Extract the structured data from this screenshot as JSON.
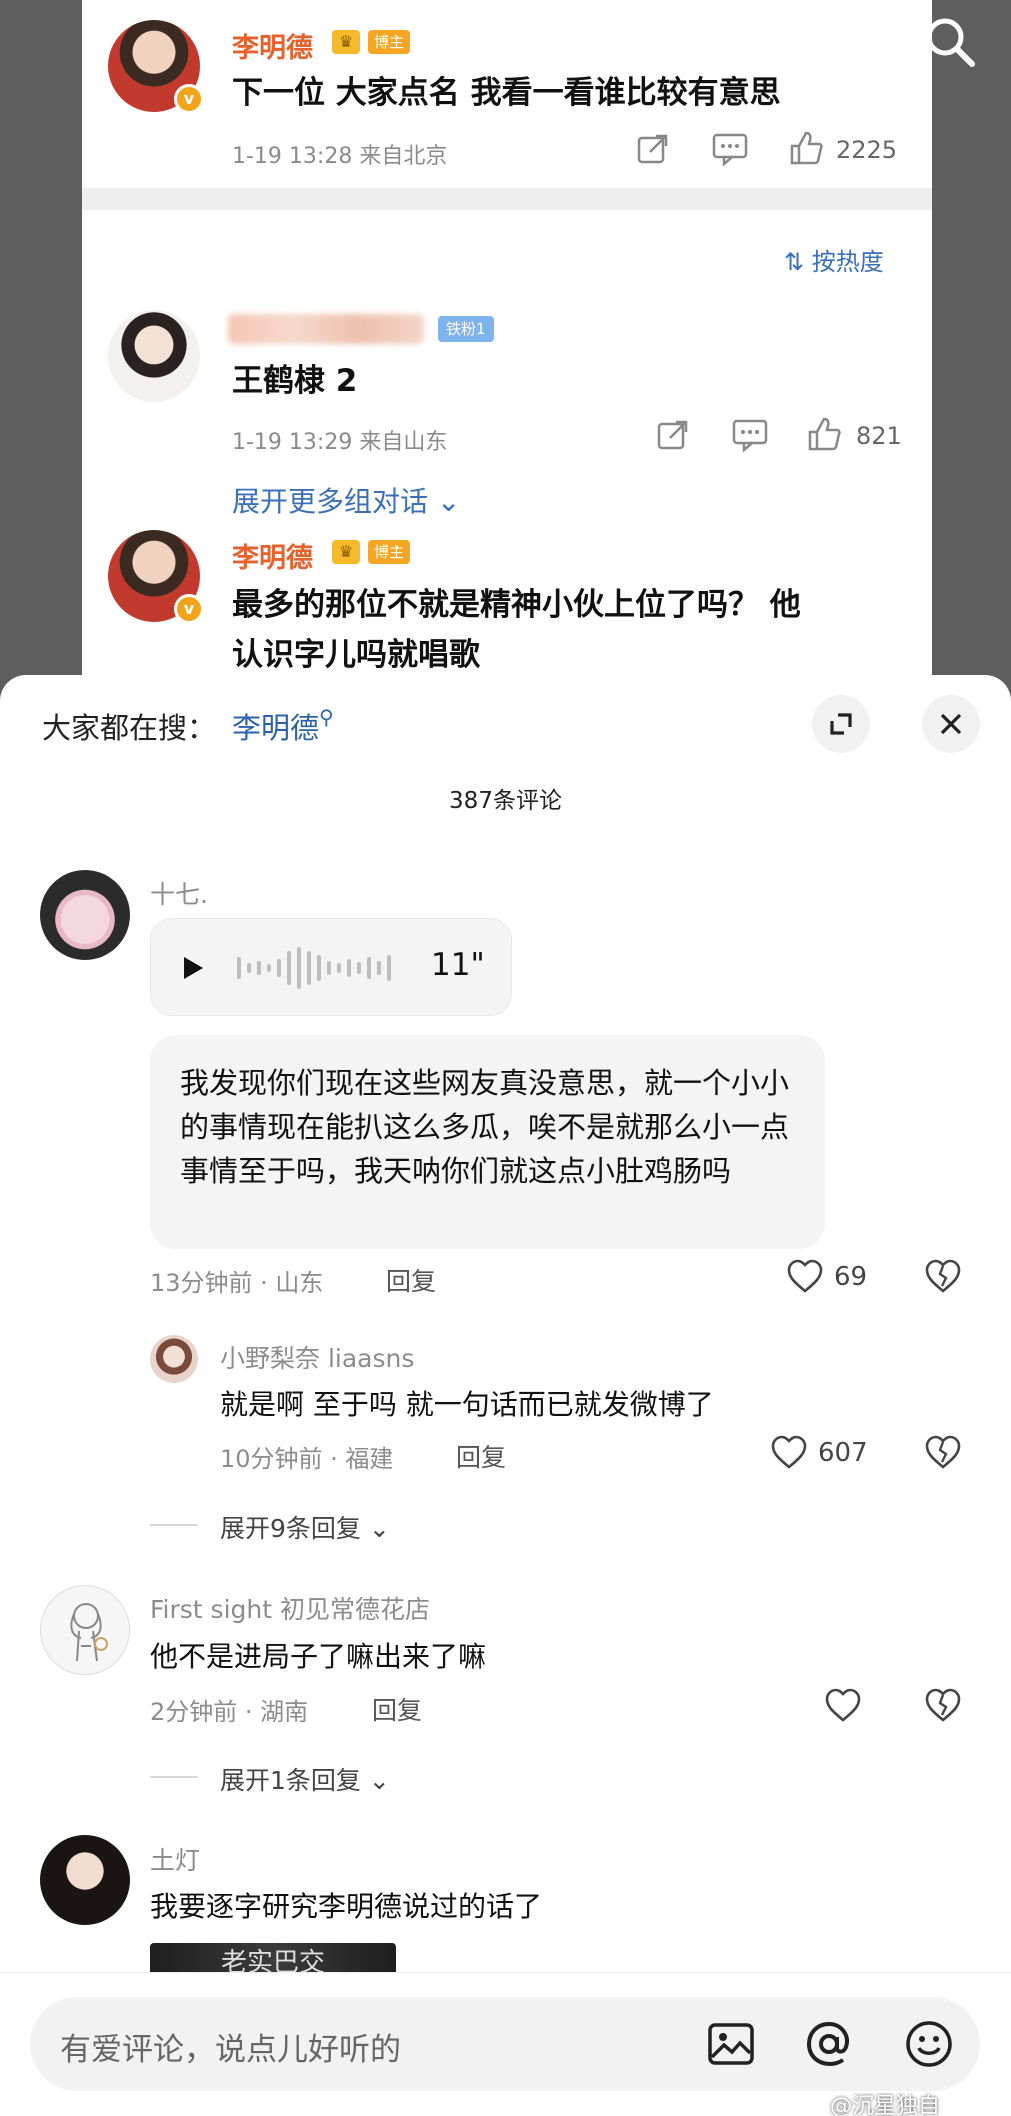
{
  "weibo": {
    "post": {
      "author": "李明德",
      "badge": "博主",
      "text": "下一位 大家点名 我看一看谁比较有意思",
      "meta": "1-19 13:28 来自北京",
      "likes": "2225"
    },
    "sort_label": "按热度",
    "reply1": {
      "fan_badge": "铁粉1",
      "text": "王鹤棣 2",
      "meta": "1-19 13:29 来自山东",
      "likes": "821"
    },
    "expand_more": "展开更多组对话",
    "reply2": {
      "author": "李明德",
      "badge": "博主",
      "text_line1": "最多的那位不就是精神小伙上位了吗？ 他",
      "text_line2": "认识字儿吗就唱歌"
    }
  },
  "sheet": {
    "search_label": "大家都在搜：",
    "search_term": "李明德",
    "comment_count": "387条评论",
    "comments": [
      {
        "name": "十七.",
        "voice_duration": "11\"",
        "text": "我发现你们现在这些网友真没意思，就一个小小的事情现在能扒这么多瓜，唉不是就那么小一点事情至于吗，我天呐你们就这点小肚鸡肠吗",
        "meta": "13分钟前 · 山东",
        "reply_label": "回复",
        "likes": "69",
        "sub_reply": {
          "name": "小野梨奈 liaasns",
          "text": "就是啊 至于吗 就一句话而已就发微博了",
          "meta": "10分钟前 · 福建",
          "reply_label": "回复",
          "likes": "607"
        },
        "expand": "展开9条回复"
      },
      {
        "name": "First sight 初见常德花店",
        "text": "他不是进局子了嘛出来了嘛",
        "meta": "2分钟前 · 湖南",
        "reply_label": "回复",
        "expand": "展开1条回复"
      },
      {
        "name": "土灯",
        "text": "我要逐字研究李明德说过的话了",
        "image_text": "老实巴交"
      }
    ]
  },
  "bottom_bar": {
    "placeholder": "有爱评论，说点儿好听的",
    "icons": [
      "image-icon",
      "at-icon",
      "emoji-icon"
    ]
  },
  "watermark": "@沉星独自",
  "colors": {
    "name_orange": "#e8602c",
    "link_blue": "#2b62ad",
    "badge_orange": "#f7a623",
    "fan_badge_blue": "#7fb3ee"
  }
}
